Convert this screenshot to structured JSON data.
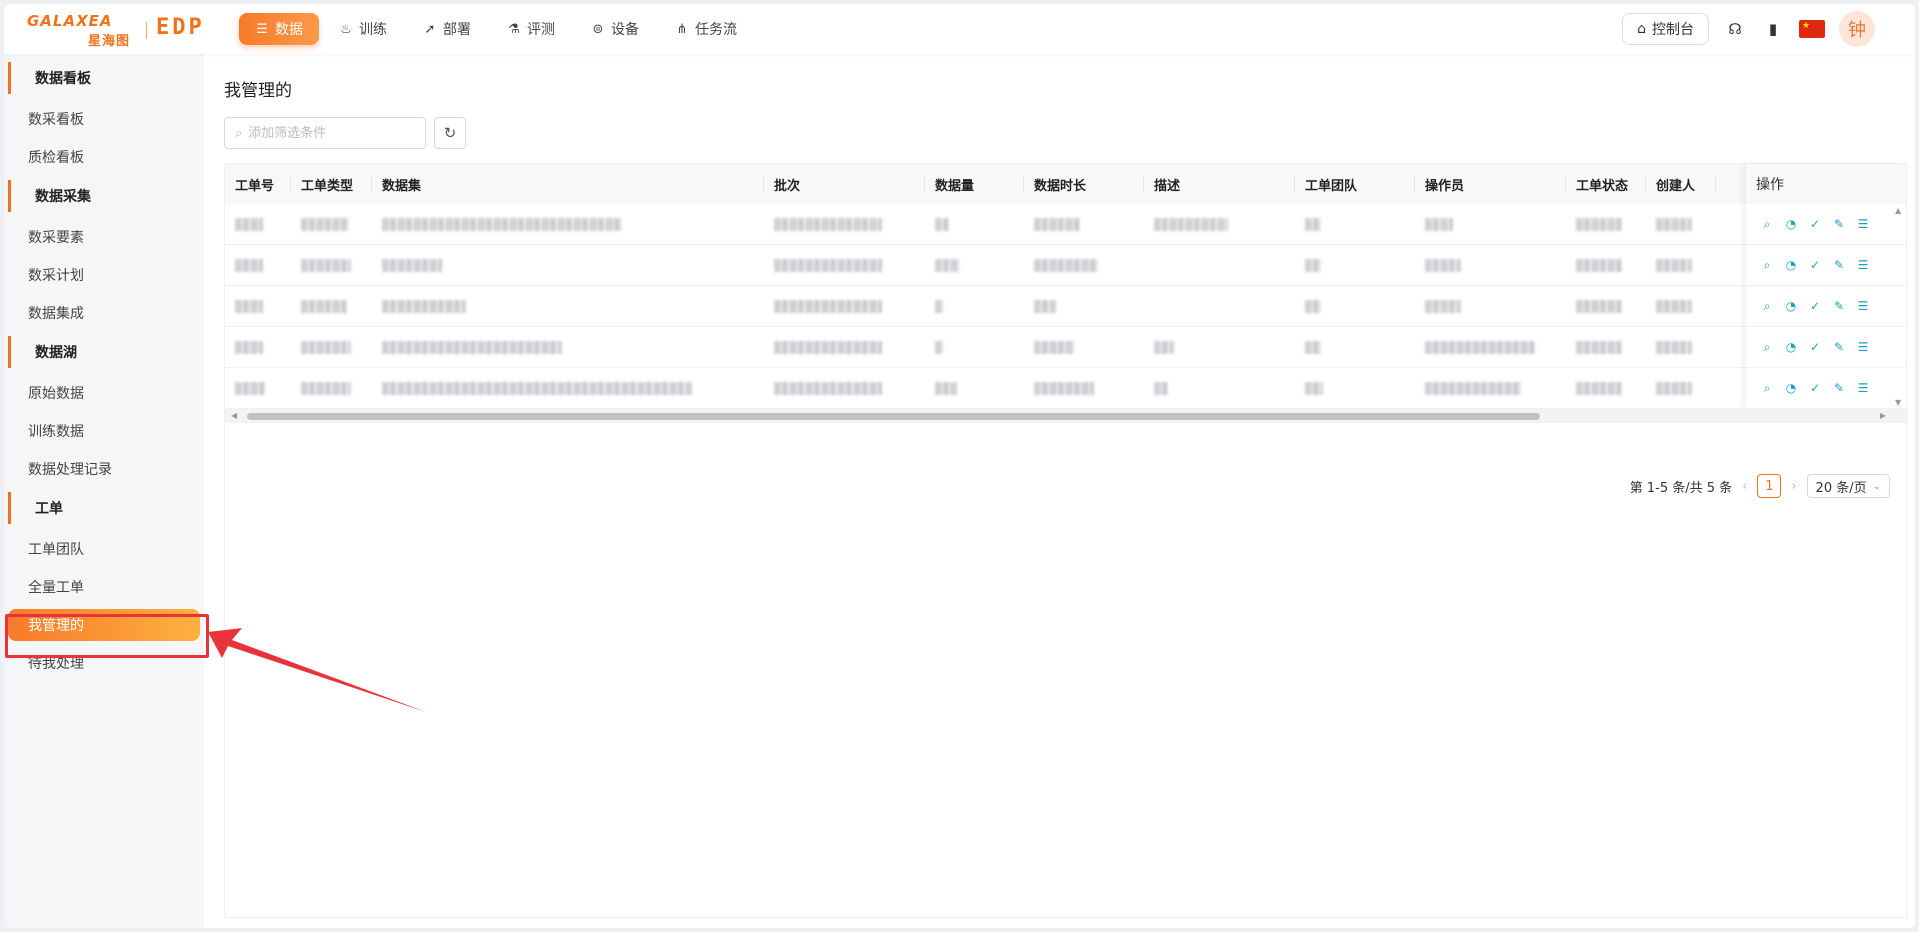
{
  "header": {
    "logo_word": "GALAXEA",
    "logo_cn": "星海图",
    "logo_product": "EDP",
    "nav": [
      {
        "label": "数据",
        "icon": "database-icon",
        "active": true
      },
      {
        "label": "训练",
        "icon": "flame-icon",
        "active": false
      },
      {
        "label": "部署",
        "icon": "rocket-icon",
        "active": false
      },
      {
        "label": "评测",
        "icon": "flask-icon",
        "active": false
      },
      {
        "label": "设备",
        "icon": "robot-icon",
        "active": false
      },
      {
        "label": "任务流",
        "icon": "flow-icon",
        "active": false
      }
    ],
    "console_label": "控制台",
    "avatar_text": "钟"
  },
  "sidebar": {
    "groups": [
      {
        "label": "数据看板",
        "items": [
          "数采看板",
          "质检看板"
        ]
      },
      {
        "label": "数据采集",
        "items": [
          "数采要素",
          "数采计划",
          "数据集成"
        ]
      },
      {
        "label": "数据湖",
        "items": [
          "原始数据",
          "训练数据",
          "数据处理记录"
        ]
      },
      {
        "label": "工单",
        "items": [
          "工单团队",
          "全量工单",
          "我管理的",
          "待我处理"
        ]
      }
    ],
    "active_item": "我管理的"
  },
  "main": {
    "title": "我管理的",
    "search_placeholder": "添加筛选条件",
    "columns": [
      "工单号",
      "工单类型",
      "数据集",
      "批次",
      "数据量",
      "数据时长",
      "描述",
      "工单团队",
      "操作员",
      "工单状态",
      "创建人",
      "操作"
    ],
    "row_count": 5,
    "pagination": {
      "summary": "第 1-5 条/共 5 条",
      "current_page": "1",
      "page_size": "20 条/页"
    }
  },
  "colors": {
    "accent": "#f2711c",
    "action_icon": "#1aa3b8",
    "annotation": "#e8333b"
  }
}
